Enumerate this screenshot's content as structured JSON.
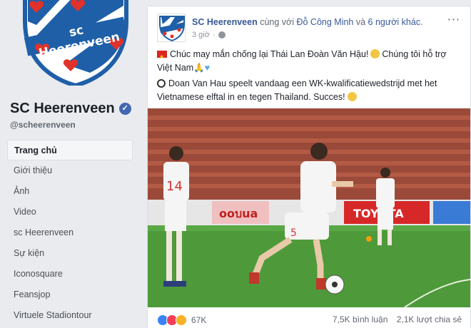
{
  "page": {
    "name": "SC Heerenveen",
    "handle": "@scheerenveen",
    "logo_text": "sc Heerenveen"
  },
  "nav": [
    {
      "label": "Trang chủ",
      "active": true
    },
    {
      "label": "Giới thiệu"
    },
    {
      "label": "Ảnh"
    },
    {
      "label": "Video"
    },
    {
      "label": "sc Heerenveen"
    },
    {
      "label": "Sự kiện"
    },
    {
      "label": "Iconosquare"
    },
    {
      "label": "Feansjop"
    },
    {
      "label": "Virtuele Stadiontour"
    }
  ],
  "post": {
    "author": "SC Heerenveen",
    "with_text": " cùng với ",
    "tagged": "Đỗ Công Minh",
    "and_text": " và ",
    "others": "6 người khác",
    "dot": ".",
    "time": "3 giờ",
    "line1_a": "Chúc may mắn chống lại Thái Lan Đoàn Văn Hậu!",
    "line1_b": "Chúng tôi hỗ trợ Việt Nam",
    "line2": "Doan Van Hau speelt vandaag een WK-kwalificatiewedstrijd met het Vietnamese elftal in en tegen Thailand. Succes!",
    "photo": {
      "player1_number": "14",
      "player2_number": "5",
      "board_text_1": "ooบua",
      "board_text_2": "TOYOTA"
    },
    "reaction_count": "67K",
    "comments": "7,5K bình luận",
    "shares": "2,1K lượt chia sẻ"
  },
  "colors": {
    "link": "#385898",
    "logo_blue": "#1f5fa8",
    "heart_red": "#e0322b",
    "pitch_green": "#4e9a3a"
  }
}
